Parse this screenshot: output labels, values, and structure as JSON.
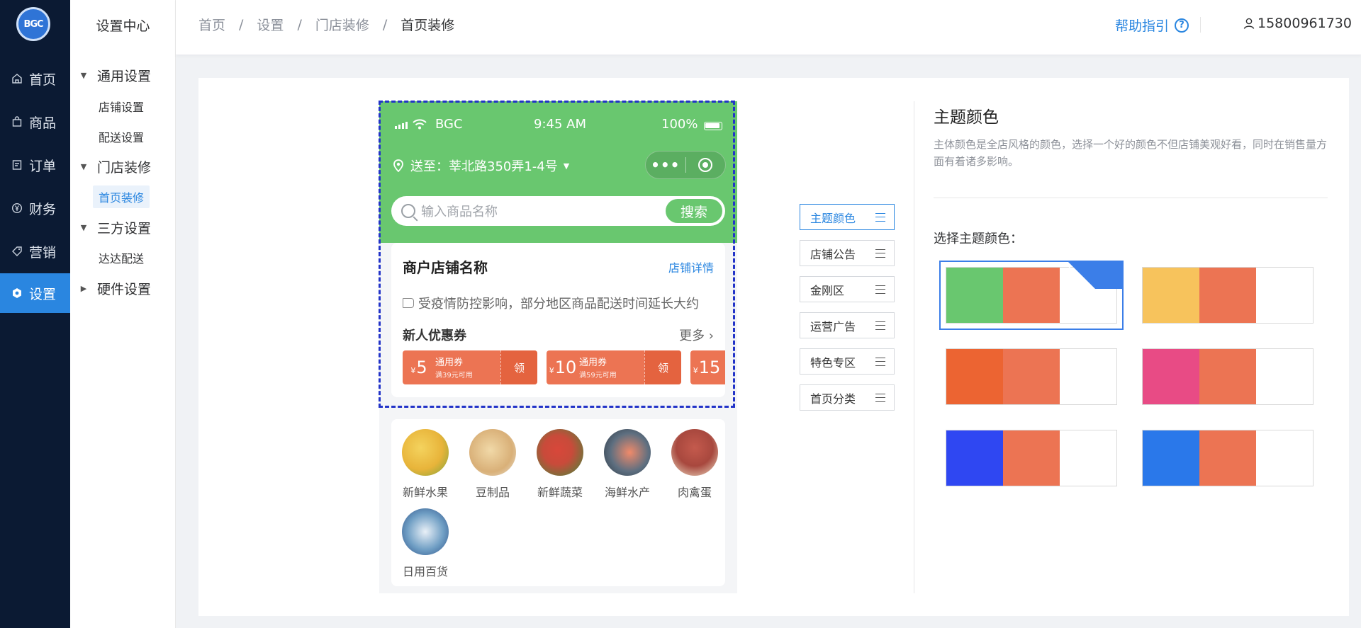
{
  "logo": "BGC",
  "nav": {
    "items": [
      {
        "label": "首页",
        "icon": "home-icon"
      },
      {
        "label": "商品",
        "icon": "bag-icon"
      },
      {
        "label": "订单",
        "icon": "order-icon"
      },
      {
        "label": "财务",
        "icon": "yen-icon"
      },
      {
        "label": "营销",
        "icon": "tag-icon"
      },
      {
        "label": "设置",
        "icon": "gear-icon",
        "active": true
      }
    ]
  },
  "side": {
    "title": "设置中心",
    "groups": [
      {
        "label": "通用设置",
        "expanded": true,
        "items": [
          "店铺设置",
          "配送设置"
        ]
      },
      {
        "label": "门店装修",
        "expanded": true,
        "items": [
          "首页装修"
        ]
      },
      {
        "label": "三方设置",
        "expanded": true,
        "items": [
          "达达配送"
        ]
      },
      {
        "label": "硬件设置",
        "expanded": false,
        "items": []
      }
    ],
    "active_item": "首页装修"
  },
  "header": {
    "breadcrumb": [
      "首页",
      "设置",
      "门店装修",
      "首页装修"
    ],
    "separator": "/",
    "help": "帮助指引",
    "help_icon": "?",
    "user": "15800961730"
  },
  "phone": {
    "carrier": "BGC",
    "time": "9:45 AM",
    "battery": "100%",
    "location": "送至：莘北路350弄1-4号",
    "capsule_dots": "•••",
    "search_placeholder": "输入商品名称",
    "search_button": "搜索",
    "store_name": "商户店铺名称",
    "store_link": "店铺详情",
    "notice": "受疫情防控影响，部分地区商品配送时间延长大约",
    "coupon_title": "新人优惠券",
    "more": "更多 ›",
    "coupons": [
      {
        "currency": "¥",
        "amount": "5",
        "type": "通用券",
        "condition": "满39元可用",
        "action": "领"
      },
      {
        "currency": "¥",
        "amount": "10",
        "type": "通用券",
        "condition": "满59元可用",
        "action": "领"
      },
      {
        "currency": "¥",
        "amount": "15",
        "type": "",
        "condition": "",
        "action": ""
      }
    ],
    "categories": [
      {
        "label": "新鲜水果",
        "color": "#e8b43a"
      },
      {
        "label": "豆制品",
        "color": "#d9b078"
      },
      {
        "label": "新鲜蔬菜",
        "color": "#c84b3a"
      },
      {
        "label": "海鲜水产",
        "color": "#5e6f80"
      },
      {
        "label": "肉禽蛋",
        "color": "#a8483e"
      },
      {
        "label": "日用百货",
        "color": "#6f9ec4"
      }
    ]
  },
  "modules": [
    {
      "label": "主题颜色",
      "active": true
    },
    {
      "label": "店铺公告"
    },
    {
      "label": "金刚区"
    },
    {
      "label": "运营广告"
    },
    {
      "label": "特色专区"
    },
    {
      "label": "首页分类"
    }
  ],
  "panel": {
    "title": "主题颜色",
    "description": "主体颜色是全店风格的颜色，选择一个好的颜色不但店铺美观好看，同时在销售量方面有着诸多影响。",
    "choose_label": "选择主题颜色：",
    "check_mark": "✓",
    "themes": [
      {
        "primary": "#69c76f",
        "secondary": "#ec7453",
        "selected": true
      },
      {
        "primary": "#f7c35c",
        "secondary": "#ec7453"
      },
      {
        "primary": "#ec6432",
        "secondary": "#ec7453"
      },
      {
        "primary": "#e84b85",
        "secondary": "#ec7453"
      },
      {
        "primary": "#2f47f2",
        "secondary": "#ec7453"
      },
      {
        "primary": "#2a78ea",
        "secondary": "#ec7453"
      }
    ]
  },
  "colors": {
    "nav_bg": "#0b1a33",
    "accent": "#2a86e0",
    "phone_green": "#69c76f",
    "coupon": "#ec7453"
  }
}
